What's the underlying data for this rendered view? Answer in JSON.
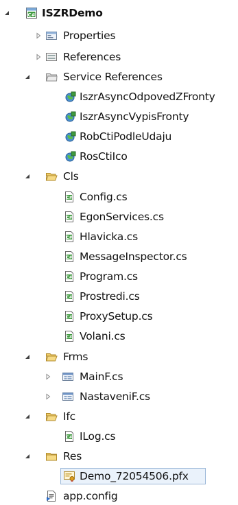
{
  "tree": {
    "root": {
      "label": "ISZRDemo",
      "icon": "csharp-project-icon"
    },
    "properties": {
      "label": "Properties",
      "icon": "properties-icon"
    },
    "references": {
      "label": "References",
      "icon": "references-icon"
    },
    "service_references": {
      "label": "Service References",
      "icon": "folder-icon",
      "items": [
        {
          "label": "IszrAsyncOdpovedZFronty",
          "icon": "service-reference-icon"
        },
        {
          "label": "IszrAsyncVypisFronty",
          "icon": "service-reference-icon"
        },
        {
          "label": "RobCtiPodleUdaju",
          "icon": "service-reference-icon"
        },
        {
          "label": "RosCtiIco",
          "icon": "service-reference-icon"
        }
      ]
    },
    "cls": {
      "label": "Cls",
      "icon": "folder-open-icon",
      "items": [
        {
          "label": "Config.cs",
          "icon": "csharp-file-icon"
        },
        {
          "label": "EgonServices.cs",
          "icon": "csharp-file-icon"
        },
        {
          "label": "Hlavicka.cs",
          "icon": "csharp-file-icon"
        },
        {
          "label": "MessageInspector.cs",
          "icon": "csharp-file-icon"
        },
        {
          "label": "Program.cs",
          "icon": "csharp-file-icon"
        },
        {
          "label": "Prostredi.cs",
          "icon": "csharp-file-icon"
        },
        {
          "label": "ProxySetup.cs",
          "icon": "csharp-file-icon"
        },
        {
          "label": "Volani.cs",
          "icon": "csharp-file-icon"
        }
      ]
    },
    "frms": {
      "label": "Frms",
      "icon": "folder-open-icon",
      "items": [
        {
          "label": "MainF.cs",
          "icon": "form-icon"
        },
        {
          "label": "NastaveniF.cs",
          "icon": "form-icon"
        }
      ]
    },
    "ifc": {
      "label": "Ifc",
      "icon": "folder-open-icon",
      "items": [
        {
          "label": "ILog.cs",
          "icon": "csharp-file-icon"
        }
      ]
    },
    "res": {
      "label": "Res",
      "icon": "folder-icon",
      "items": [
        {
          "label": "Demo_72054506.pfx",
          "icon": "certificate-icon",
          "selected": true
        }
      ]
    },
    "app_config": {
      "label": "app.config",
      "icon": "config-file-icon"
    }
  },
  "colors": {
    "selection_bg": "#eaf2fb",
    "selection_border": "#9cb8d8",
    "folder": "#e8c35a",
    "csharp_green": "#3a8a3a"
  }
}
